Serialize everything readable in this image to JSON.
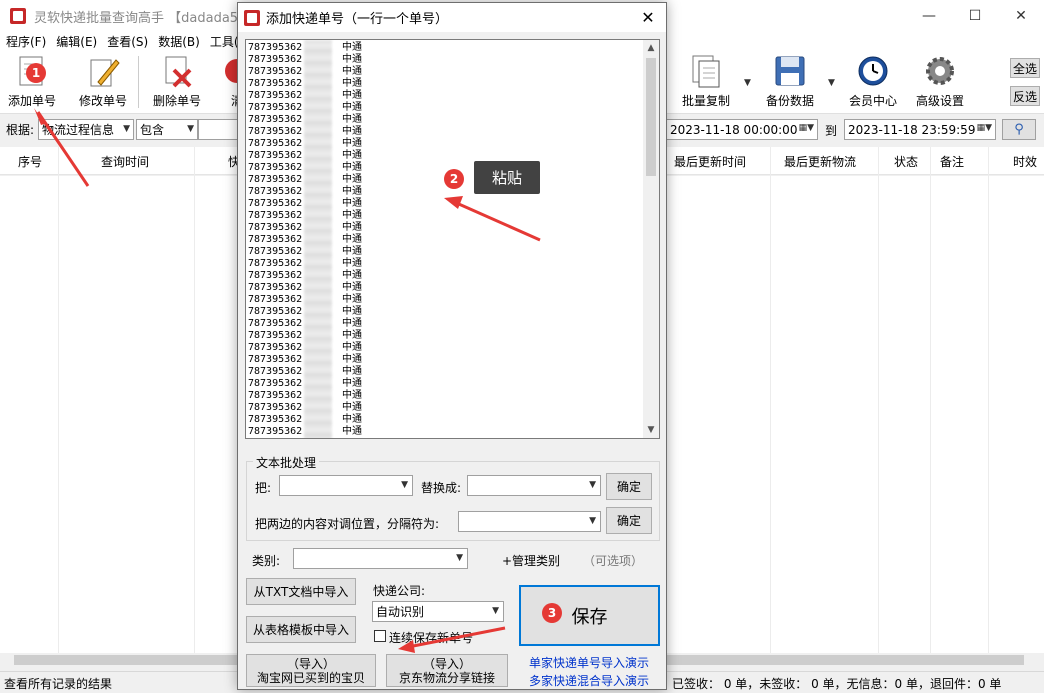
{
  "main_window": {
    "title": "灵软快递批量查询高手 【dadada5100",
    "menu": [
      "程序(F)",
      "编辑(E)",
      "查看(S)",
      "数据(B)",
      "工具("
    ],
    "toolbar": {
      "add": "添加单号",
      "edit": "修改单号",
      "delete": "删除单号",
      "clear": "清",
      "batch_copy": "批量复制",
      "backup": "备份数据",
      "member": "会员中心",
      "advanced": "高级设置",
      "select_all": "全选",
      "invert": "反选"
    },
    "filter": {
      "basis_label": "根据:",
      "basis_value": "物流过程信息",
      "mode_value": "包含",
      "date_from": "2023-11-18 00:00:00",
      "to_label": "到",
      "date_to": "2023-11-18 23:59:59"
    },
    "columns": [
      "序号",
      "查询时间",
      "快",
      "最后更新时间",
      "最后更新物流",
      "状态",
      "备注",
      "时效"
    ],
    "status": {
      "left": "查看所有记录的结果",
      "right": "已签收：  0 单，未签收：  0 单，无信息：0 单，退回件：0 单"
    }
  },
  "dialog": {
    "title": "添加快递单号（一行一个单号）",
    "lines": {
      "number_prefix": "787395362",
      "company": "中通",
      "count": 33
    },
    "text_batch": {
      "legend": "文本批处理",
      "from_label": "把:",
      "replace_label": "替换成:",
      "ok_1": "确定",
      "swap_label": "把两边的内容对调位置，分隔符为:",
      "ok_2": "确定"
    },
    "category_label": "类别:",
    "manage_category": "+管理类别",
    "optional": "（可选项）",
    "import_txt": "从TXT文档中导入",
    "import_template": "从表格模板中导入",
    "courier_label": "快递公司:",
    "courier_value": "自动识别",
    "continuous_save": "连续保存新单号",
    "save": "保存",
    "import_taobao_line1": "（导入）",
    "import_taobao_line2": "淘宝网已买到的宝贝",
    "import_jd_line1": "（导入）",
    "import_jd_line2": "京东物流分享链接",
    "link_single": "单家快递单号导入演示",
    "link_multi": "多家快递混合导入演示"
  },
  "annotations": {
    "step1": "1",
    "step2": "2",
    "step3": "3",
    "paste_tip": "粘贴",
    "arrow_color": "#e53935"
  }
}
